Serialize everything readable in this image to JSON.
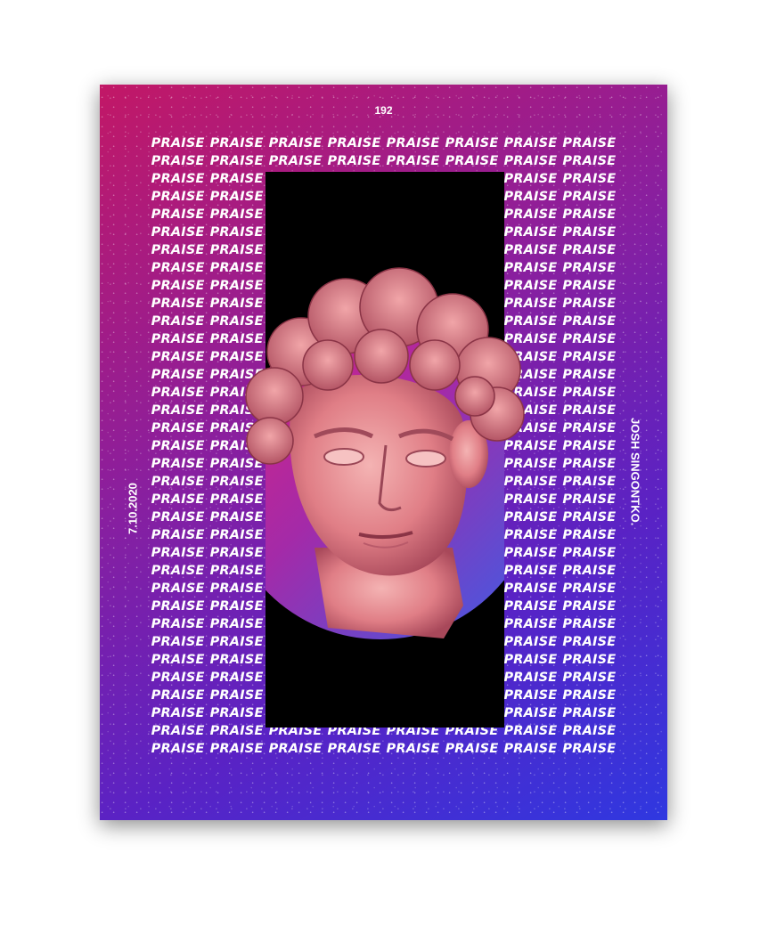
{
  "poster": {
    "issue_number": "192",
    "repeated_word": "PRAISE",
    "date": "7.10.2020",
    "author": "JOSH SINGONTKO."
  },
  "colors": {
    "gradient_start": "#c21866",
    "gradient_mid": "#5a22c4",
    "gradient_end": "#2f38e0",
    "bust_pink": "#e8878f",
    "rect": "#000000"
  },
  "artwork": {
    "subject": "classical-marble-bust-icon"
  }
}
